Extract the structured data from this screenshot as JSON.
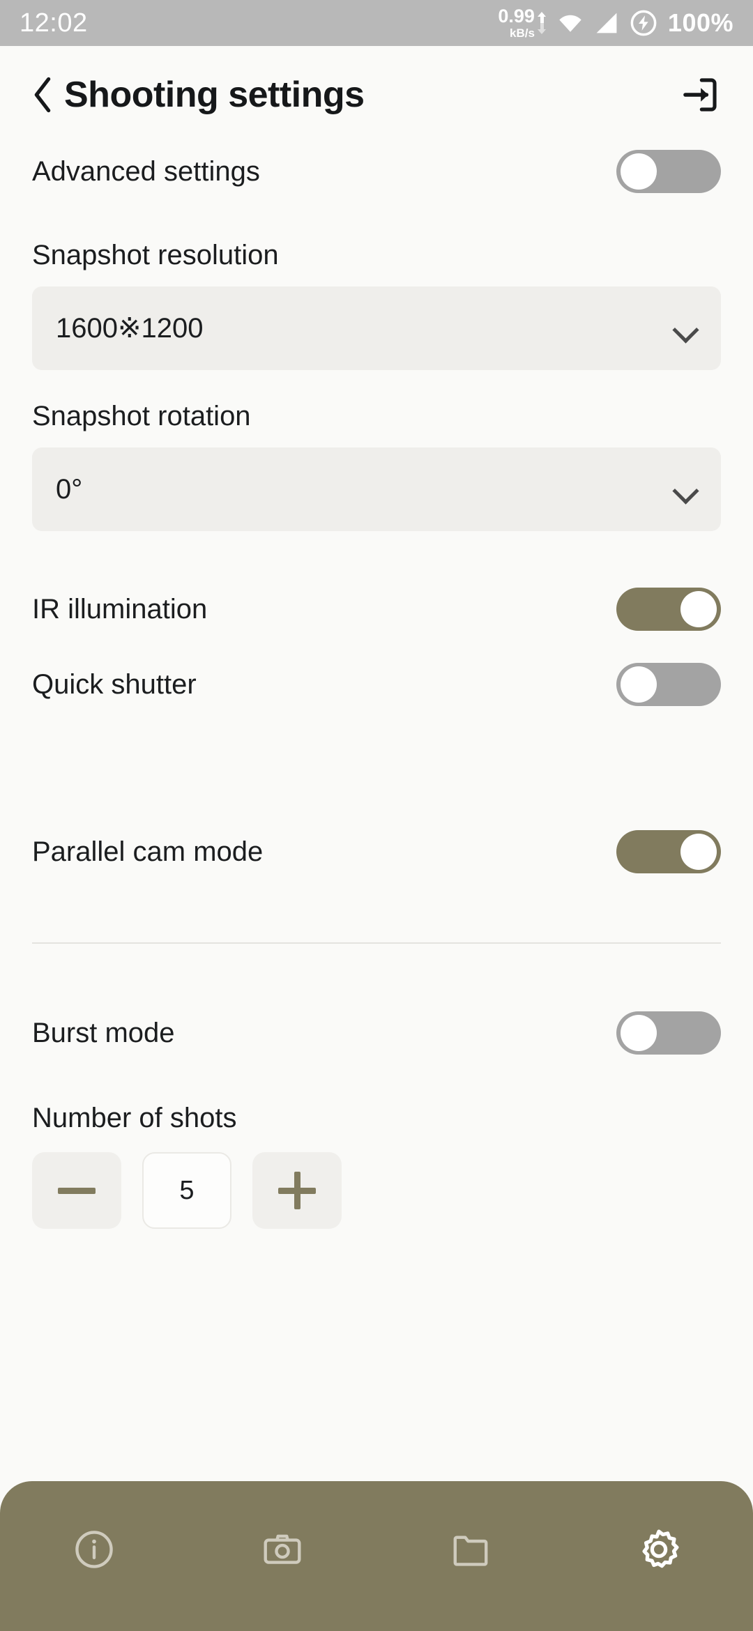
{
  "status_bar": {
    "clock": "12:02",
    "network_speed_value": "0.99",
    "network_speed_unit": "kB/s",
    "battery_percent": "100%",
    "icons": [
      "upload-arrow-icon",
      "download-arrow-icon",
      "wifi-icon",
      "cellular-signal-icon",
      "battery-charging-icon"
    ]
  },
  "header": {
    "title": "Shooting settings",
    "back_icon": "chevron-left-icon",
    "action_icon": "login-enter-icon"
  },
  "settings": {
    "advanced_settings": {
      "label": "Advanced settings",
      "state": "off"
    },
    "snapshot_resolution": {
      "label": "Snapshot resolution",
      "value": "1600※1200"
    },
    "snapshot_rotation": {
      "label": "Snapshot rotation",
      "value": "0°"
    },
    "ir_illumination": {
      "label": "IR illumination",
      "state": "on"
    },
    "quick_shutter": {
      "label": "Quick shutter",
      "state": "off"
    },
    "parallel_cam_mode": {
      "label": "Parallel cam mode",
      "state": "on"
    },
    "burst_mode": {
      "label": "Burst mode",
      "state": "off"
    },
    "number_of_shots": {
      "label": "Number of shots",
      "value": "5",
      "decrement": "−",
      "increment": "+"
    }
  },
  "bottom_nav": {
    "items": [
      {
        "name": "info",
        "icon": "info-circle-icon",
        "active": false
      },
      {
        "name": "camera",
        "icon": "camera-icon",
        "active": false
      },
      {
        "name": "files",
        "icon": "folder-icon",
        "active": false
      },
      {
        "name": "settings",
        "icon": "gear-icon",
        "active": true
      }
    ]
  },
  "colors": {
    "accent_olive": "#817B5E",
    "toggle_off_gray": "#A3A3A3",
    "page_background": "#FAFAF8",
    "field_background": "#EFEEEB",
    "status_bar_background": "#B8B8B8"
  }
}
